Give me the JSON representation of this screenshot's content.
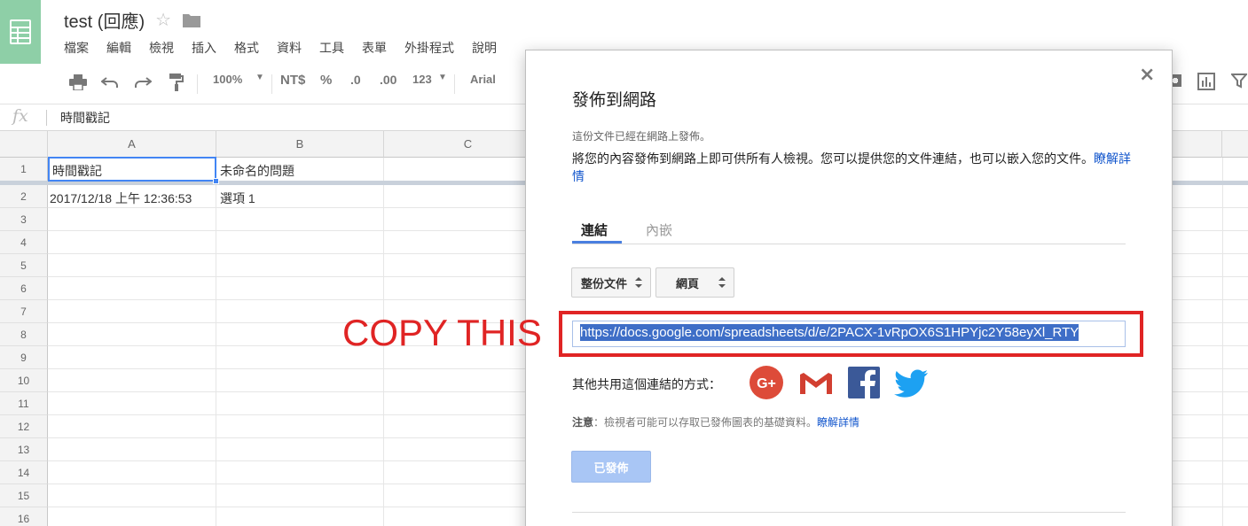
{
  "app": {
    "title": "test (回應)",
    "menu": [
      "檔案",
      "編輯",
      "檢視",
      "插入",
      "格式",
      "資料",
      "工具",
      "表單",
      "外掛程式",
      "說明"
    ]
  },
  "toolbar": {
    "zoom": "100%",
    "currency": "NT$",
    "percent": "%",
    "decimal_less": ".0",
    "decimal_more": ".00",
    "more_formats": "123",
    "font": "Arial"
  },
  "formula_bar": {
    "fx": "fx",
    "value": "時間戳記"
  },
  "grid": {
    "columns": [
      "A",
      "B",
      "C"
    ],
    "rows": [
      "1",
      "2",
      "3",
      "4",
      "5",
      "6",
      "7",
      "8",
      "9",
      "10",
      "11",
      "12",
      "13",
      "14",
      "15",
      "16"
    ],
    "cells": {
      "a1": "時間戳記",
      "b1": "未命名的問題",
      "a2": "2017/12/18 上午 12:36:53",
      "b2": "選項 1"
    }
  },
  "dialog": {
    "title": "發佈到網路",
    "close": "×",
    "status": "這份文件已經在網路上發佈。",
    "description": "將您的內容發佈到網路上即可供所有人檢視。您可以提供您的文件連結，也可以嵌入您的文件。",
    "learn_more": "瞭解詳情",
    "tabs": [
      "連結",
      "內嵌"
    ],
    "scope_dropdown": "整份文件",
    "format_dropdown": "網頁",
    "url": "https://docs.google.com/spreadsheets/d/e/2PACX-1vRpOX6S1HPYjc2Y58eyXl_RTY",
    "share_label": "其他共用這個連結的方式：",
    "note_label": "注意",
    "note_text": "：檢視者可能可以存取已發佈圖表的基礎資料。",
    "note_link": "瞭解詳情",
    "publish_button": "已發佈"
  },
  "annotation": {
    "label": "COPY THIS",
    "color": "#e02424"
  },
  "colors": {
    "sheets_green": "#8ecfa7",
    "selection_blue": "#4285f4",
    "link_blue": "#1155cc"
  }
}
